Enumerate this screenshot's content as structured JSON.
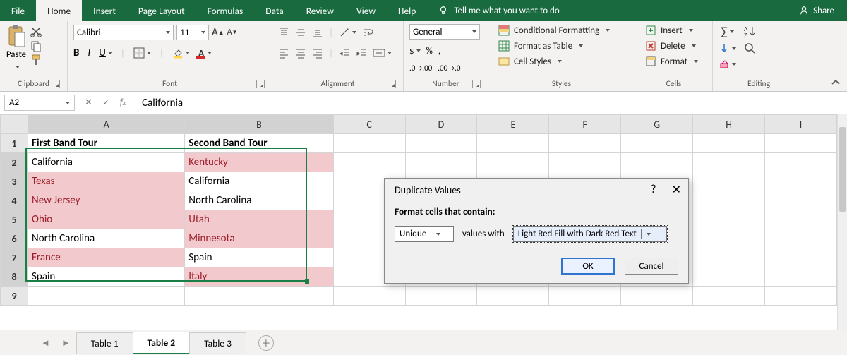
{
  "menubar": {
    "tabs": [
      "File",
      "Home",
      "Insert",
      "Page Layout",
      "Formulas",
      "Data",
      "Review",
      "View",
      "Help"
    ],
    "active": "Home",
    "tell": "Tell me what you want to do",
    "share": "Share"
  },
  "ribbon": {
    "clipboard": {
      "label": "Clipboard",
      "paste": "Paste"
    },
    "font": {
      "label": "Font",
      "family": "Calibri",
      "size": "11",
      "bold": "B",
      "italic": "I",
      "underline": "U"
    },
    "alignment": {
      "label": "Alignment"
    },
    "number": {
      "label": "Number",
      "format": "General",
      "currency": "$",
      "percent": "%",
      "comma": ",",
      "incdec1": ".0",
      "incdec2": ".00"
    },
    "styles": {
      "label": "Styles",
      "cond": "Conditional Formatting",
      "table": "Format as Table",
      "cell": "Cell Styles"
    },
    "cells": {
      "label": "Cells",
      "insert": "Insert",
      "delete": "Delete",
      "format": "Format"
    },
    "editing": {
      "label": "Editing"
    }
  },
  "formulaBar": {
    "name": "A2",
    "value": "California"
  },
  "columns": [
    "A",
    "B",
    "C",
    "D",
    "E",
    "F",
    "G",
    "H",
    "I"
  ],
  "rows": [
    "1",
    "2",
    "3",
    "4",
    "5",
    "6",
    "7",
    "8",
    "9"
  ],
  "table": {
    "headers": {
      "a": "First Band Tour",
      "b": "Second Band Tour"
    },
    "data": [
      {
        "a": "California",
        "aHL": false,
        "b": "Kentucky",
        "bHL": true
      },
      {
        "a": "Texas",
        "aHL": true,
        "b": "California",
        "bHL": false
      },
      {
        "a": "New Jersey",
        "aHL": true,
        "b": "North Carolina",
        "bHL": false
      },
      {
        "a": "Ohio",
        "aHL": true,
        "b": "Utah",
        "bHL": true
      },
      {
        "a": "North Carolina",
        "aHL": false,
        "b": "Minnesota",
        "bHL": true
      },
      {
        "a": "France",
        "aHL": true,
        "b": "Spain",
        "bHL": false
      },
      {
        "a": "Spain",
        "aHL": false,
        "b": "Italy",
        "bHL": true
      }
    ]
  },
  "sheetTabs": {
    "tabs": [
      "Table 1",
      "Table 2",
      "Table 3"
    ],
    "active": "Table 2"
  },
  "dialog": {
    "title": "Duplicate Values",
    "subtitle": "Format cells that contain:",
    "mode": "Unique",
    "with": "values with",
    "format": "Light Red Fill with Dark Red Text",
    "ok": "OK",
    "cancel": "Cancel"
  }
}
